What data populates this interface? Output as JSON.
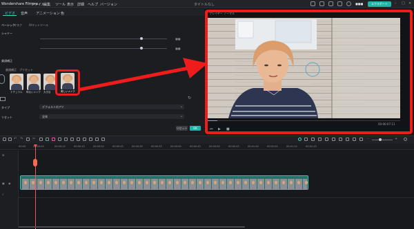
{
  "menubar": {
    "app_name": "Wondershare Filmora",
    "items": [
      "ファイル",
      "編集",
      "ツール",
      "表示",
      "詳細",
      "ヘルプ",
      "バージョン"
    ],
    "window_title": "タイトルなし",
    "export_label": "エクスポート"
  },
  "panel": {
    "tabs": [
      "ビデオ",
      "音声",
      "アニメーション",
      "色"
    ],
    "sub_tabs": [
      "ベーシック",
      "マスク",
      "AIマットツール"
    ],
    "section_shadow": "シャドー",
    "section_face": "美顔補正",
    "face_tabs": [
      "美顔補正",
      "プリセット"
    ],
    "presets": [
      "ナチュラル",
      "明るいメイク",
      "大き目",
      "美しいメイク"
    ],
    "type_label": "タイプ",
    "type_value": "デフォルトのアイ",
    "select_label": "リセット",
    "select_value": "全体",
    "reset_label": "リセット",
    "ok_label": "OK"
  },
  "preview": {
    "tabs": [
      "プレイヤー",
      "ノーマル"
    ],
    "timecode": "00:00:07:11"
  },
  "timeline": {
    "ticks": [
      "00:00",
      "00:00:05",
      "00:00:10",
      "00:00:15",
      "00:00:20",
      "00:00:25",
      "00:00:30",
      "00:00:35",
      "00:00:40",
      "00:00:45",
      "00:00:50",
      "00:00:55",
      "00:01:00",
      "00:01:05",
      "00:01:10",
      "00:01:15"
    ]
  },
  "colors": {
    "accent": "#1fb5a8",
    "highlight": "#ef1c1c",
    "playhead": "#f05a4a"
  }
}
